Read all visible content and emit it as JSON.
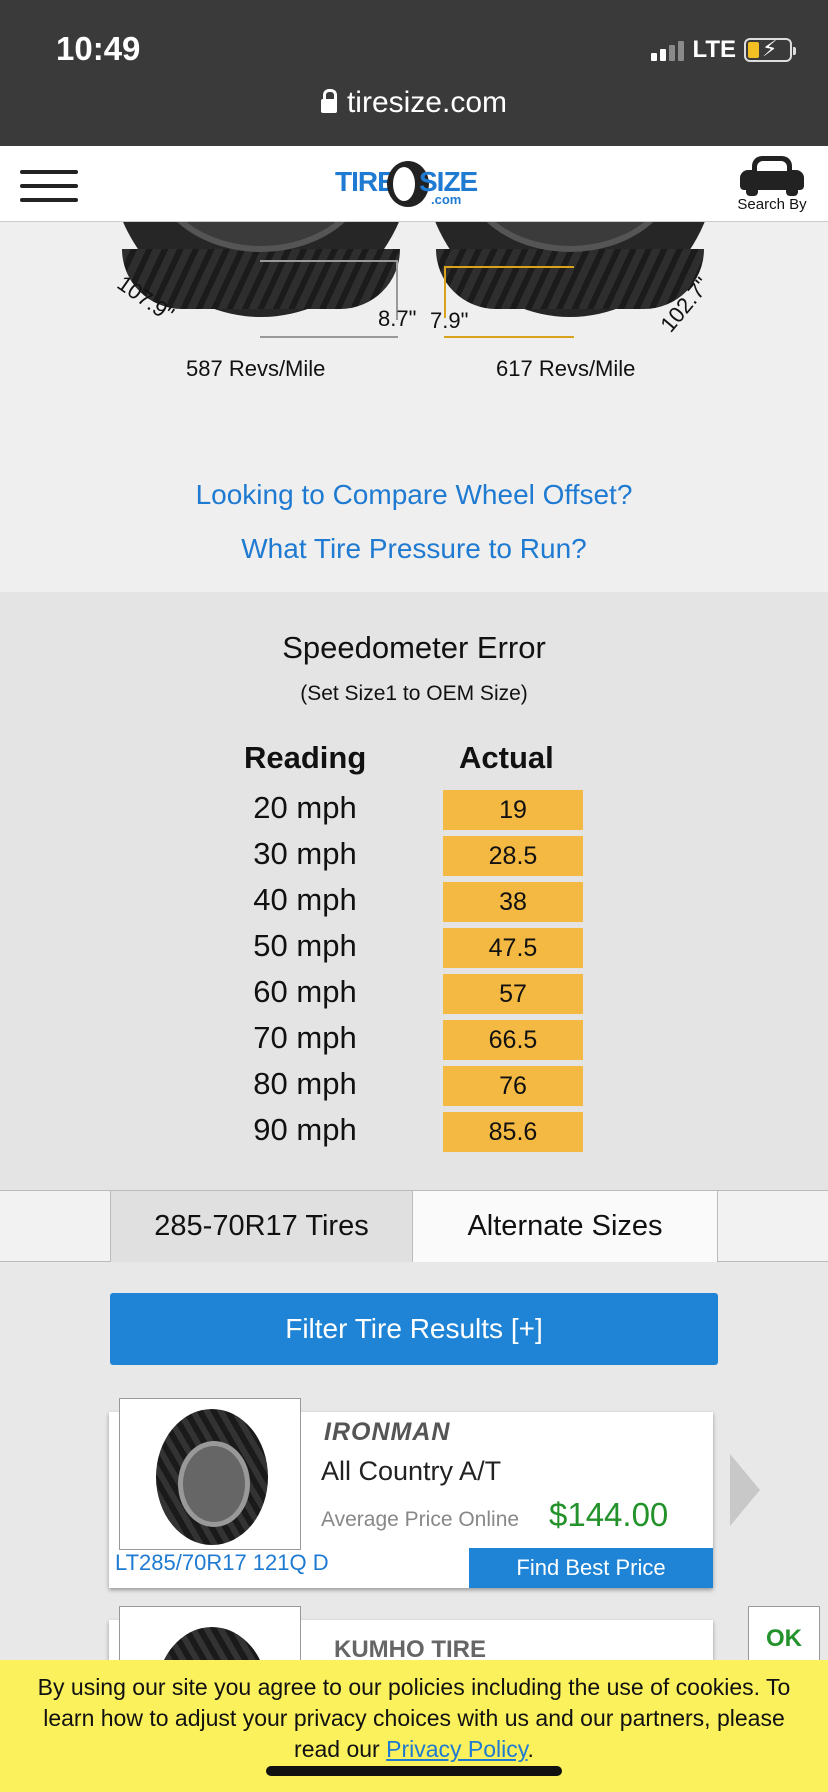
{
  "status_bar": {
    "time": "10:49",
    "network": "LTE",
    "url": "tiresize.com"
  },
  "header": {
    "logo": {
      "tire": "TIRE",
      "size": "SIZE",
      "com": ".com"
    },
    "search_by_label": "Search By"
  },
  "diagram": {
    "left_circumference": "107.9\"",
    "right_circumference": "102.7\"",
    "left_sidewall": "8.7\"",
    "right_sidewall": "7.9\"",
    "left_revs": "587 Revs/Mile",
    "right_revs": "617 Revs/Mile"
  },
  "links": {
    "wheel_offset": "Looking to Compare Wheel Offset?",
    "tire_pressure": "What Tire Pressure to Run?"
  },
  "speedometer": {
    "title": "Speedometer Error",
    "subtitle": "(Set Size1 to OEM Size)",
    "reading_header": "Reading",
    "actual_header": "Actual",
    "rows": [
      {
        "reading": "20 mph",
        "actual": "19"
      },
      {
        "reading": "30 mph",
        "actual": "28.5"
      },
      {
        "reading": "40 mph",
        "actual": "38"
      },
      {
        "reading": "50 mph",
        "actual": "47.5"
      },
      {
        "reading": "60 mph",
        "actual": "57"
      },
      {
        "reading": "70 mph",
        "actual": "66.5"
      },
      {
        "reading": "80 mph",
        "actual": "76"
      },
      {
        "reading": "90 mph",
        "actual": "85.6"
      }
    ]
  },
  "tabs": {
    "tires": "285-70R17 Tires",
    "alternate": "Alternate Sizes"
  },
  "results": {
    "filter_label": "Filter Tire Results [+]",
    "cards": [
      {
        "brand": "IRONMAN",
        "model": "All Country A/T",
        "avg_label": "Average Price Online",
        "price": "$144.00",
        "size": "LT285/70R17 121Q D",
        "button": "Find Best Price"
      },
      {
        "brand": "KUMHO TIRE"
      }
    ]
  },
  "cookie": {
    "text": "By using our site you agree to our policies including the use of cookies. To learn how to adjust your privacy choices with us and our partners, please read our",
    "link": "Privacy Policy",
    "end": ".",
    "ok": "OK"
  },
  "colors": {
    "accent_blue": "#1f84d6",
    "price_green": "#23922b",
    "actual_highlight": "#f4b942",
    "cookie_bg": "#faf15d"
  }
}
